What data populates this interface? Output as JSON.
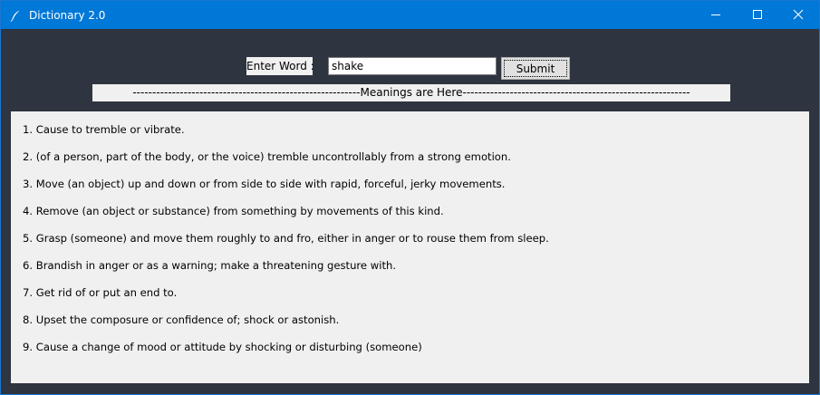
{
  "window": {
    "title": "Dictionary 2.0",
    "controls": {
      "minimize_icon": "minimize-icon",
      "maximize_icon": "maximize-icon",
      "close_icon": "close-icon"
    }
  },
  "colors": {
    "titlebar": "#0078d7",
    "window_background": "#2e3440",
    "panel_background": "#f0f0f0"
  },
  "form": {
    "label": "Enter Word :",
    "input_value": "shake",
    "submit_label": "Submit"
  },
  "meanings_header": "----------------------------------------------------------Meanings are Here----------------------------------------------------------",
  "meanings": [
    "1. Cause to tremble or vibrate.",
    "2. (of a person, part of the body, or the voice) tremble uncontrollably from a strong emotion.",
    "3. Move (an object) up and down or from side to side with rapid, forceful, jerky movements.",
    "4. Remove (an object or substance) from something by movements of this kind.",
    "5. Grasp (someone) and move them roughly to and fro, either in anger or to rouse them from sleep.",
    "6. Brandish in anger or as a warning; make a threatening gesture with.",
    "7. Get rid of or put an end to.",
    "8. Upset the composure or confidence of; shock or astonish.",
    "9. Cause a change of mood or attitude by shocking or disturbing (someone)"
  ]
}
